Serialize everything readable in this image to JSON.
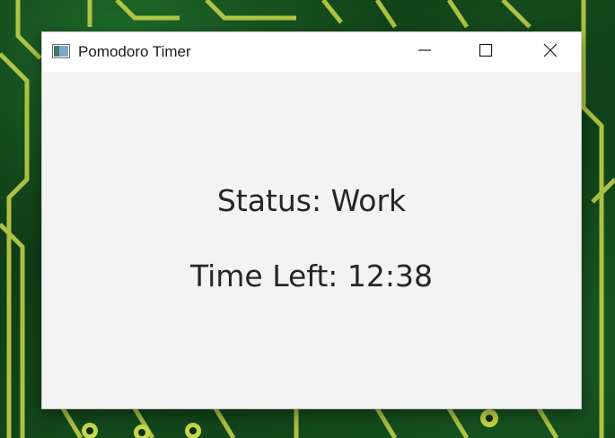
{
  "window": {
    "title": "Pomodoro Timer",
    "icon": "app-window-icon",
    "controls": {
      "minimize_icon": "minimize-icon",
      "maximize_icon": "maximize-icon",
      "close_icon": "close-icon"
    }
  },
  "timer": {
    "status_text": "Status: Work",
    "time_left_text": "Time Left: 12:38"
  },
  "colors": {
    "content_background": "#f3f3f3",
    "titlebar_background": "#ffffff",
    "text": "#262626",
    "wallpaper": "#0f3a17"
  }
}
